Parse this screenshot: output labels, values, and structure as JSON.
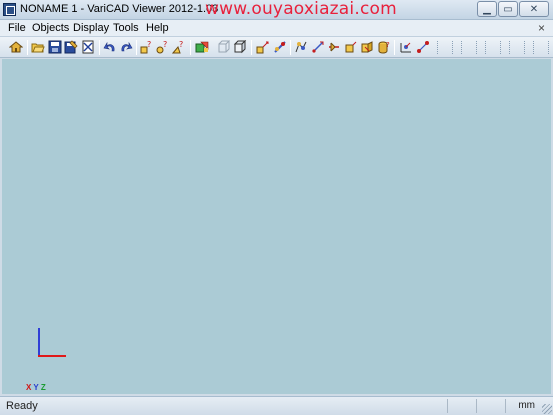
{
  "window": {
    "title": "NONAME 1 - VariCAD Viewer 2012-1.03",
    "watermark": "www.ouyaoxiazai.com"
  },
  "menu": [
    {
      "label": "File"
    },
    {
      "label": "Objects"
    },
    {
      "label": "Display"
    },
    {
      "label": "Tools"
    },
    {
      "label": "Help"
    }
  ],
  "mdi_close": "×",
  "toolbar_icons": [
    "home-icon",
    "open-folder-icon",
    "save-icon",
    "save-as-icon",
    "print-icon",
    "undo-icon",
    "redo-icon",
    "query-object-icon",
    "query-distance-icon",
    "query-angle-icon",
    "color-icon",
    "box-frame-icon",
    "box-solid-icon",
    "dimension-icon",
    "rotate-icon",
    "coordinate-icon",
    "point-icon",
    "section-icon",
    "surface-icon",
    "solid-icon",
    "axis-icon",
    "move-icon"
  ],
  "canvas": {
    "background": "#abcbd5",
    "axis_labels": {
      "x": "X",
      "y": "Y",
      "z": "Z"
    }
  },
  "status": {
    "text": "Ready",
    "unit": "mm"
  }
}
